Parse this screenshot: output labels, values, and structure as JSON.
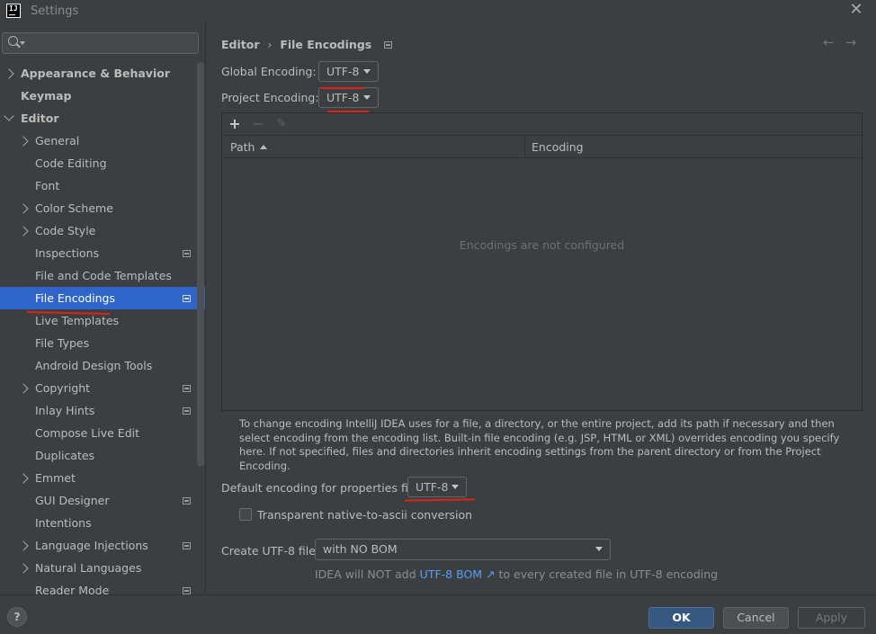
{
  "window": {
    "title": "Settings",
    "logo_text": "IJ"
  },
  "sidebar": {
    "search": {
      "placeholder": "",
      "value": ""
    },
    "items": [
      {
        "label": "Appearance & Behavior",
        "level": 0,
        "expand": "collapsed",
        "bold": true,
        "icon": ""
      },
      {
        "label": "Keymap",
        "level": 0,
        "expand": "none",
        "bold": true,
        "icon": ""
      },
      {
        "label": "Editor",
        "level": 0,
        "expand": "expanded",
        "bold": true,
        "icon": ""
      },
      {
        "label": "General",
        "level": 1,
        "expand": "collapsed",
        "icon": ""
      },
      {
        "label": "Code Editing",
        "level": 1,
        "expand": "none",
        "icon": ""
      },
      {
        "label": "Font",
        "level": 1,
        "expand": "none",
        "icon": ""
      },
      {
        "label": "Color Scheme",
        "level": 1,
        "expand": "collapsed",
        "icon": ""
      },
      {
        "label": "Code Style",
        "level": 1,
        "expand": "collapsed",
        "icon": ""
      },
      {
        "label": "Inspections",
        "level": 1,
        "expand": "none",
        "icon": "project-settings-icon"
      },
      {
        "label": "File and Code Templates",
        "level": 1,
        "expand": "none",
        "icon": ""
      },
      {
        "label": "File Encodings",
        "level": 1,
        "expand": "none",
        "icon": "project-settings-icon",
        "selected": true
      },
      {
        "label": "Live Templates",
        "level": 1,
        "expand": "none",
        "icon": ""
      },
      {
        "label": "File Types",
        "level": 1,
        "expand": "none",
        "icon": ""
      },
      {
        "label": "Android Design Tools",
        "level": 1,
        "expand": "none",
        "icon": ""
      },
      {
        "label": "Copyright",
        "level": 1,
        "expand": "collapsed",
        "icon": "project-settings-icon"
      },
      {
        "label": "Inlay Hints",
        "level": 1,
        "expand": "none",
        "icon": "project-settings-icon"
      },
      {
        "label": "Compose Live Edit",
        "level": 1,
        "expand": "none",
        "icon": ""
      },
      {
        "label": "Duplicates",
        "level": 1,
        "expand": "none",
        "icon": ""
      },
      {
        "label": "Emmet",
        "level": 1,
        "expand": "collapsed",
        "icon": ""
      },
      {
        "label": "GUI Designer",
        "level": 1,
        "expand": "none",
        "icon": "project-settings-icon"
      },
      {
        "label": "Intentions",
        "level": 1,
        "expand": "none",
        "icon": ""
      },
      {
        "label": "Language Injections",
        "level": 1,
        "expand": "collapsed",
        "icon": "project-settings-icon"
      },
      {
        "label": "Natural Languages",
        "level": 1,
        "expand": "collapsed",
        "icon": ""
      },
      {
        "label": "Reader Mode",
        "level": 1,
        "expand": "none",
        "icon": "project-settings-icon"
      }
    ]
  },
  "breadcrumb": {
    "parent": "Editor",
    "separator": "›",
    "current": "File Encodings"
  },
  "nav": {
    "back": "←",
    "forward": "→"
  },
  "global_encoding": {
    "label": "Global Encoding:",
    "value": "UTF-8"
  },
  "project_encoding": {
    "label": "Project Encoding:",
    "value": "UTF-8"
  },
  "table": {
    "toolbar": {
      "add": "+",
      "remove": "−",
      "edit": "✎"
    },
    "columns": [
      "Path",
      "Encoding"
    ],
    "sort_column": "Path",
    "rows": [],
    "empty_text": "Encodings are not configured"
  },
  "help_text": "To change encoding IntelliJ IDEA uses for a file, a directory, or the entire project, add its path if necessary and then select encoding from the encoding list. Built-in file encoding (e.g. JSP, HTML or XML) overrides encoding you specify here. If not specified, files and directories inherit encoding settings from the parent directory or from the Project Encoding.",
  "properties_encoding": {
    "label": "Default encoding for properties files:",
    "value": "UTF-8"
  },
  "native_to_ascii": {
    "label": "Transparent native-to-ascii conversion",
    "checked": false
  },
  "utf8_files": {
    "label": "Create UTF-8 files:",
    "value": "with NO BOM"
  },
  "bom_note": {
    "prefix": "IDEA will NOT add",
    "link": "UTF-8 BOM ↗",
    "suffix": "to every created file in UTF-8 encoding"
  },
  "buttons": {
    "help": "?",
    "ok": "OK",
    "cancel": "Cancel",
    "apply": "Apply"
  },
  "colors": {
    "background": "#3c3f41",
    "selection": "#2f65ca",
    "accent_link": "#589df6",
    "annotation_red": "#e0201a",
    "ok_button": "#365880"
  }
}
